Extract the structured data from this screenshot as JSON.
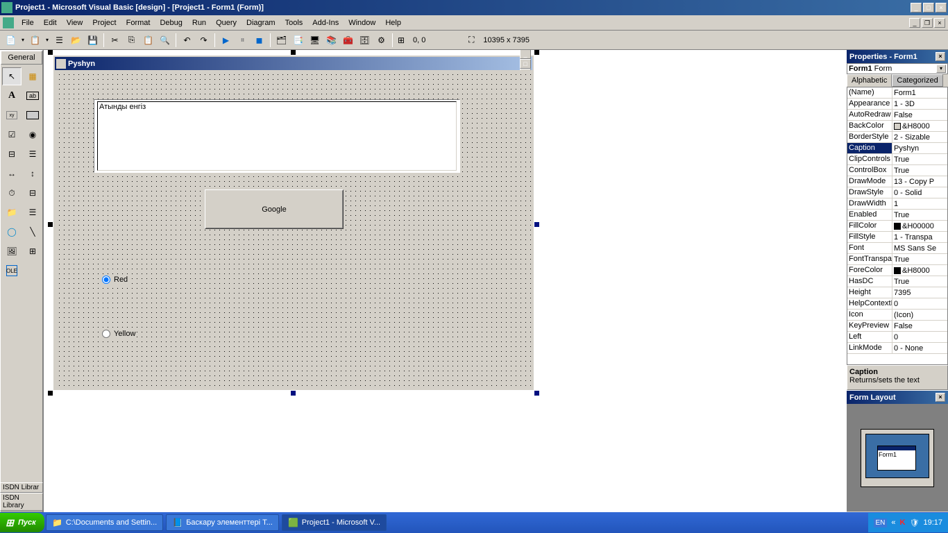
{
  "app": {
    "title": "Project1 - Microsoft Visual Basic [design] - [Project1 - Form1 (Form)]"
  },
  "menus": [
    "File",
    "Edit",
    "View",
    "Project",
    "Format",
    "Debug",
    "Run",
    "Query",
    "Diagram",
    "Tools",
    "Add-Ins",
    "Window",
    "Help"
  ],
  "toolbar": {
    "coord1": "0, 0",
    "coord2": "10395 x 7395"
  },
  "toolbox": {
    "tab": "General"
  },
  "form": {
    "caption": "Pyshyn",
    "textbox_text": "Атынды енгіз",
    "button_label": "Google",
    "radio1": "Red",
    "radio2": "Yellow"
  },
  "properties_panel": {
    "title": "Properties - Form1",
    "object_combo": "Form1 Form",
    "tabs": {
      "alphabetic": "Alphabetic",
      "categorized": "Categorized"
    },
    "rows": [
      {
        "name": "(Name)",
        "val": "Form1"
      },
      {
        "name": "Appearance",
        "val": "1 - 3D"
      },
      {
        "name": "AutoRedraw",
        "val": "False"
      },
      {
        "name": "BackColor",
        "val": "&H8000",
        "swatch": "#d4d0c8"
      },
      {
        "name": "BorderStyle",
        "val": "2 - Sizable"
      },
      {
        "name": "Caption",
        "val": "Pyshyn",
        "selected": true
      },
      {
        "name": "ClipControls",
        "val": "True"
      },
      {
        "name": "ControlBox",
        "val": "True"
      },
      {
        "name": "DrawMode",
        "val": "13 - Copy P"
      },
      {
        "name": "DrawStyle",
        "val": "0 - Solid"
      },
      {
        "name": "DrawWidth",
        "val": "1"
      },
      {
        "name": "Enabled",
        "val": "True"
      },
      {
        "name": "FillColor",
        "val": "&H00000",
        "swatch": "#000"
      },
      {
        "name": "FillStyle",
        "val": "1 - Transpa"
      },
      {
        "name": "Font",
        "val": "MS Sans Se"
      },
      {
        "name": "FontTranspar",
        "val": "True"
      },
      {
        "name": "ForeColor",
        "val": "&H8000",
        "swatch": "#000"
      },
      {
        "name": "HasDC",
        "val": "True"
      },
      {
        "name": "Height",
        "val": "7395"
      },
      {
        "name": "HelpContextI",
        "val": "0"
      },
      {
        "name": "Icon",
        "val": "(Icon)"
      },
      {
        "name": "KeyPreview",
        "val": "False"
      },
      {
        "name": "Left",
        "val": "0"
      },
      {
        "name": "LinkMode",
        "val": "0 - None"
      }
    ],
    "desc_name": "Caption",
    "desc_text": "Returns/sets the text"
  },
  "form_layout": {
    "title": "Form Layout",
    "mini_caption": "Form1"
  },
  "project_tabs": {
    "a": "ISDN Librar",
    "b": "ISDN Library"
  },
  "taskbar": {
    "start": "Пуск",
    "items": [
      "C:\\Documents and Settin...",
      "Баскару  элементтері  Т...",
      "Project1 - Microsoft V..."
    ],
    "lang": "EN",
    "time": "19:17"
  }
}
